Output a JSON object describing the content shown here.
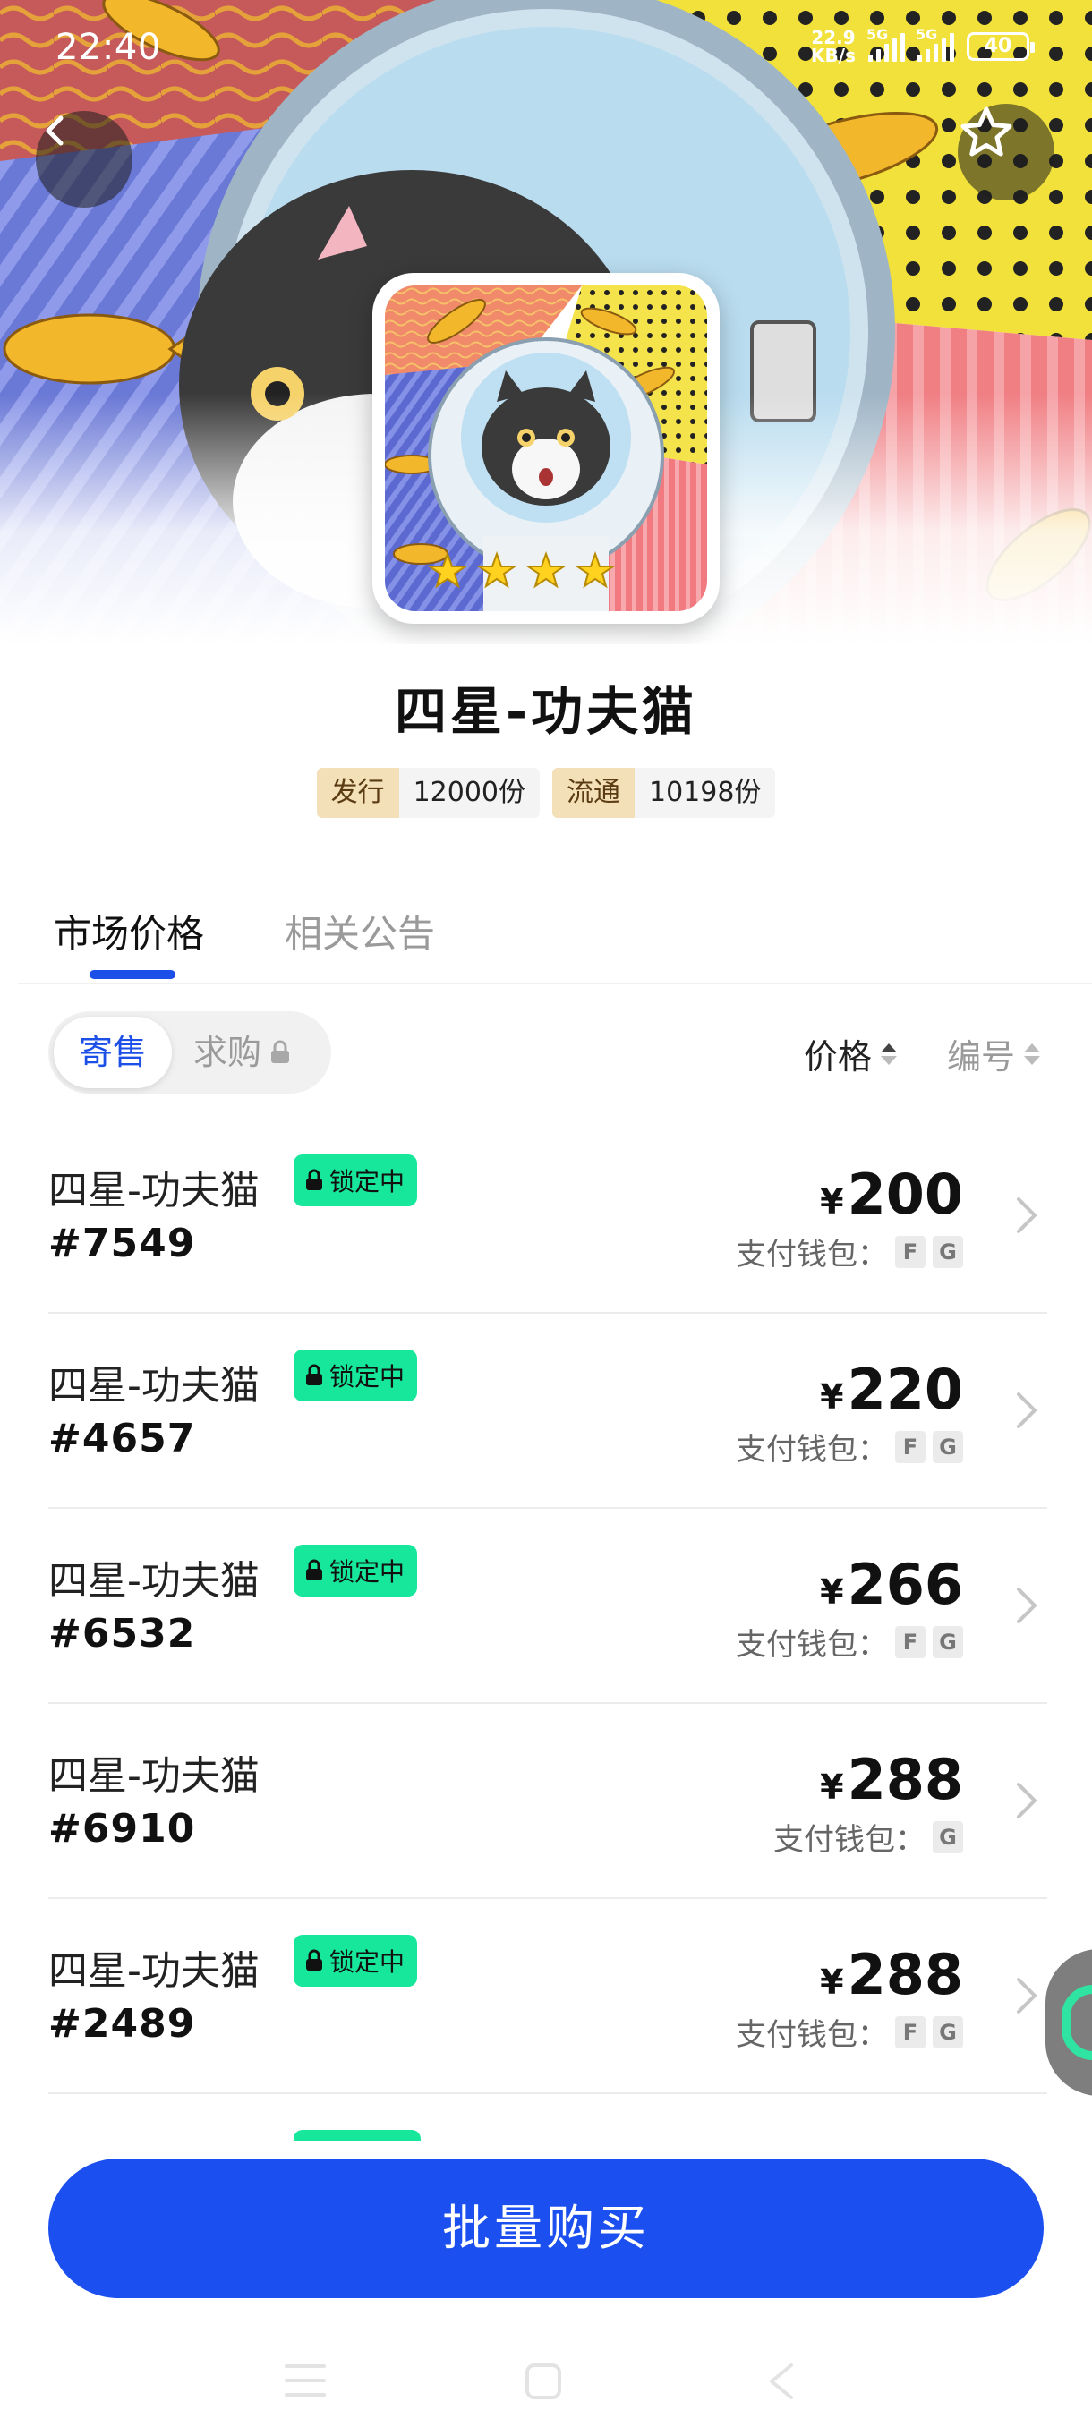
{
  "status_bar": {
    "time": "22:40",
    "net_speed_value": "22.9",
    "net_speed_unit": "KB/s",
    "signal_1_label": "5G",
    "signal_2_label": "5G",
    "battery": "40"
  },
  "header": {
    "back_icon": "chevron-left-icon",
    "favorite_icon": "star-outline-icon"
  },
  "item": {
    "title": "四星-功夫猫",
    "issued_label": "发行",
    "issued_value": "12000份",
    "circulating_label": "流通",
    "circulating_value": "10198份"
  },
  "tabs": [
    {
      "label": "市场价格",
      "active": true
    },
    {
      "label": "相关公告",
      "active": false
    }
  ],
  "filter": {
    "sale_label": "寄售",
    "buy_label": "求购",
    "sort_price_label": "价格",
    "sort_number_label": "编号"
  },
  "wallet_label": "支付钱包：",
  "currency": "¥",
  "lock_label": "锁定中",
  "listings": [
    {
      "name": "四星-功夫猫",
      "id": "#7549",
      "price": "200",
      "locked": true,
      "wallets": [
        "F",
        "G"
      ]
    },
    {
      "name": "四星-功夫猫",
      "id": "#4657",
      "price": "220",
      "locked": true,
      "wallets": [
        "F",
        "G"
      ]
    },
    {
      "name": "四星-功夫猫",
      "id": "#6532",
      "price": "266",
      "locked": true,
      "wallets": [
        "F",
        "G"
      ]
    },
    {
      "name": "四星-功夫猫",
      "id": "#6910",
      "price": "288",
      "locked": false,
      "wallets": [
        "G"
      ]
    },
    {
      "name": "四星-功夫猫",
      "id": "#2489",
      "price": "288",
      "locked": true,
      "wallets": [
        "F",
        "G"
      ]
    }
  ],
  "bulk_buy_label": "批量购买",
  "colors": {
    "accent": "#1b4fef",
    "lock_badge": "#16e79b",
    "stat_key_bg": "#f3dfb8"
  }
}
